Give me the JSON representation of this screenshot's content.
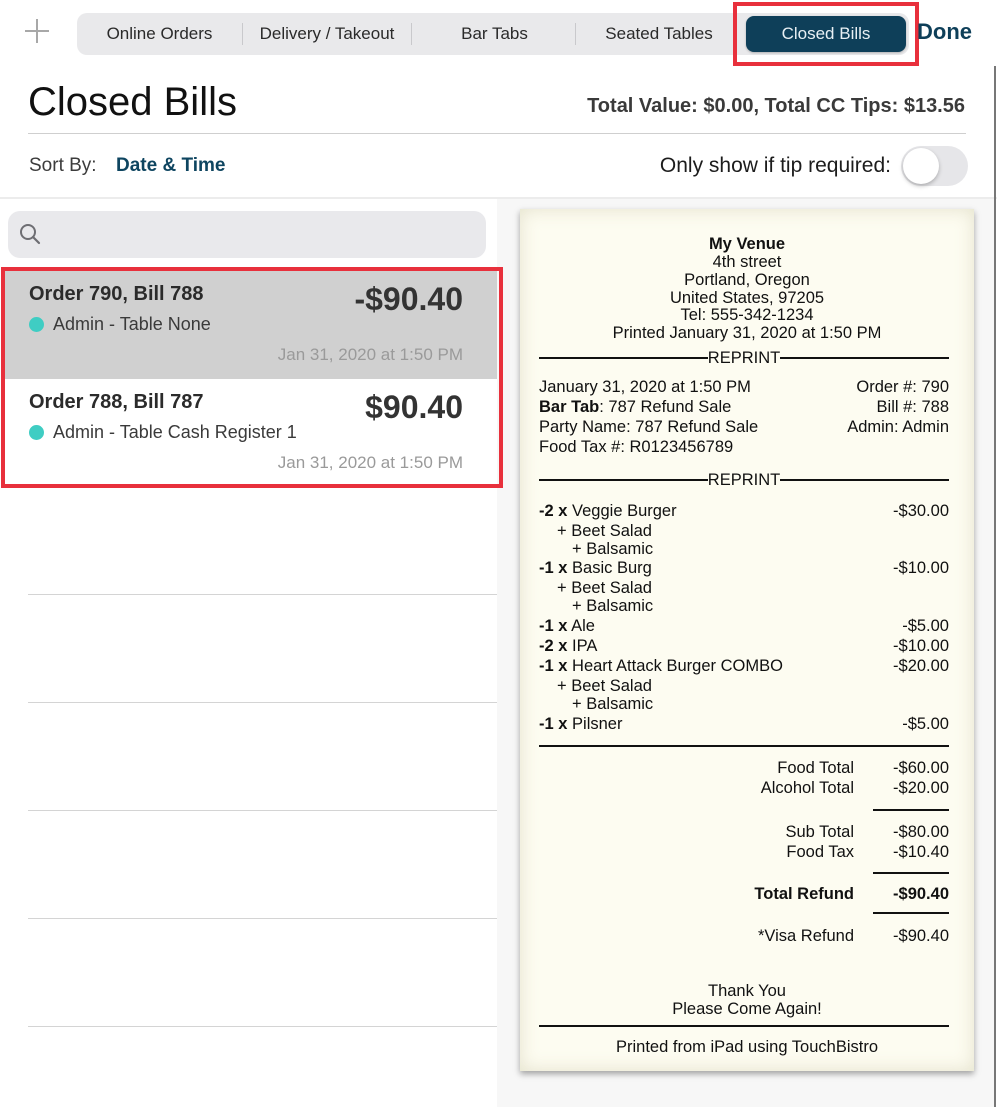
{
  "topbar": {
    "add_icon": "plus-icon",
    "tabs": [
      {
        "label": "Online Orders",
        "active": false
      },
      {
        "label": "Delivery / Takeout",
        "active": false
      },
      {
        "label": "Bar Tabs",
        "active": false
      },
      {
        "label": "Seated Tables",
        "active": false
      },
      {
        "label": "Closed Bills",
        "active": true
      }
    ],
    "done_label": "Done"
  },
  "header": {
    "title": "Closed Bills",
    "totals": "Total Value: $0.00, Total CC Tips: $13.56",
    "sort_label": "Sort By:",
    "sort_value": "Date & Time",
    "tip_filter_label": "Only show if tip required:",
    "tip_filter_on": false
  },
  "search": {
    "icon": "search-icon",
    "placeholder": "",
    "value": ""
  },
  "bills": [
    {
      "title": "Order 790, Bill 788",
      "subtitle": "Admin - Table None",
      "amount": "-$90.40",
      "date": "Jan 31, 2020 at 1:50 PM",
      "status_color": "#3fcdc3",
      "selected": true
    },
    {
      "title": "Order 788, Bill 787",
      "subtitle": "Admin - Table Cash Register 1",
      "amount": "$90.40",
      "date": "Jan 31, 2020 at 1:50 PM",
      "status_color": "#3fcdc3",
      "selected": false
    }
  ],
  "receipt": {
    "venue": "My Venue",
    "address": [
      "4th street",
      "Portland, Oregon",
      "United States, 97205",
      "Tel: 555-342-1234"
    ],
    "printed": "Printed January 31, 2020 at 1:50 PM",
    "reprint_label": "REPRINT",
    "info": {
      "datetime": "January 31, 2020 at 1:50 PM",
      "order_no": "Order #: 790",
      "bar_tab_label": "Bar Tab",
      "bar_tab_value": ": 787 Refund Sale",
      "bill_no": "Bill #: 788",
      "party_name": "Party Name: 787 Refund Sale",
      "admin": "Admin: Admin",
      "food_tax_no": "Food Tax #: R0123456789"
    },
    "items": [
      {
        "qty": "-2 x",
        "name": "Veggie Burger",
        "price": "-$30.00",
        "mods": [
          "+ Beet Salad",
          "+ Balsamic"
        ]
      },
      {
        "qty": "-1 x",
        "name": "Basic Burg",
        "price": "-$10.00",
        "mods": [
          "+ Beet Salad",
          "+ Balsamic"
        ]
      },
      {
        "qty": "-1 x",
        "name": "Ale",
        "price": "-$5.00",
        "mods": []
      },
      {
        "qty": "-2 x",
        "name": "IPA",
        "price": "-$10.00",
        "mods": []
      },
      {
        "qty": "-1 x",
        "name": "Heart Attack Burger COMBO",
        "price": "-$20.00",
        "mods": [
          "+ Beet Salad",
          "+ Balsamic"
        ]
      },
      {
        "qty": "-1 x",
        "name": "Pilsner",
        "price": "-$5.00",
        "mods": []
      }
    ],
    "totals": {
      "food_total_label": "Food Total",
      "food_total": "-$60.00",
      "alcohol_total_label": "Alcohol Total",
      "alcohol_total": "-$20.00",
      "sub_total_label": "Sub Total",
      "sub_total": "-$80.00",
      "food_tax_label": "Food Tax",
      "food_tax": "-$10.40",
      "total_refund_label": "Total Refund",
      "total_refund": "-$90.40",
      "visa_refund_label": "*Visa Refund",
      "visa_refund": "-$90.40"
    },
    "thanks": [
      "Thank You",
      "Please Come Again!"
    ],
    "footer": "Printed from iPad using TouchBistro"
  },
  "colors": {
    "accent": "#0e3f59",
    "highlight": "#e8303c",
    "status_dot": "#3fcdc3",
    "receipt_paper": "#fdfcf1"
  }
}
